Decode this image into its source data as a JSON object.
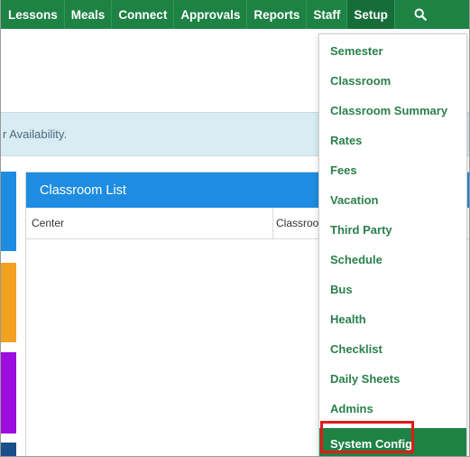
{
  "navbar": {
    "items": [
      {
        "label": "Lessons"
      },
      {
        "label": "Meals"
      },
      {
        "label": "Connect"
      },
      {
        "label": "Approvals"
      },
      {
        "label": "Reports"
      },
      {
        "label": "Staff"
      },
      {
        "label": "Setup",
        "active": true
      }
    ],
    "search_icon": "search-icon",
    "color": "#1e8245"
  },
  "alert": {
    "text": "r Availability."
  },
  "panel": {
    "title": "Classroom List",
    "columns": [
      "Center",
      "Classroom"
    ],
    "header_color": "#1e8ce0"
  },
  "setup_menu": {
    "items": [
      "Semester",
      "Classroom",
      "Classroom Summary",
      "Rates",
      "Fees",
      "Vacation",
      "Third Party",
      "Schedule",
      "Bus",
      "Health",
      "Checklist",
      "Daily Sheets",
      "Admins",
      "System Config"
    ],
    "highlighted": "System Config",
    "highlight_border_color": "#e21a1a"
  }
}
